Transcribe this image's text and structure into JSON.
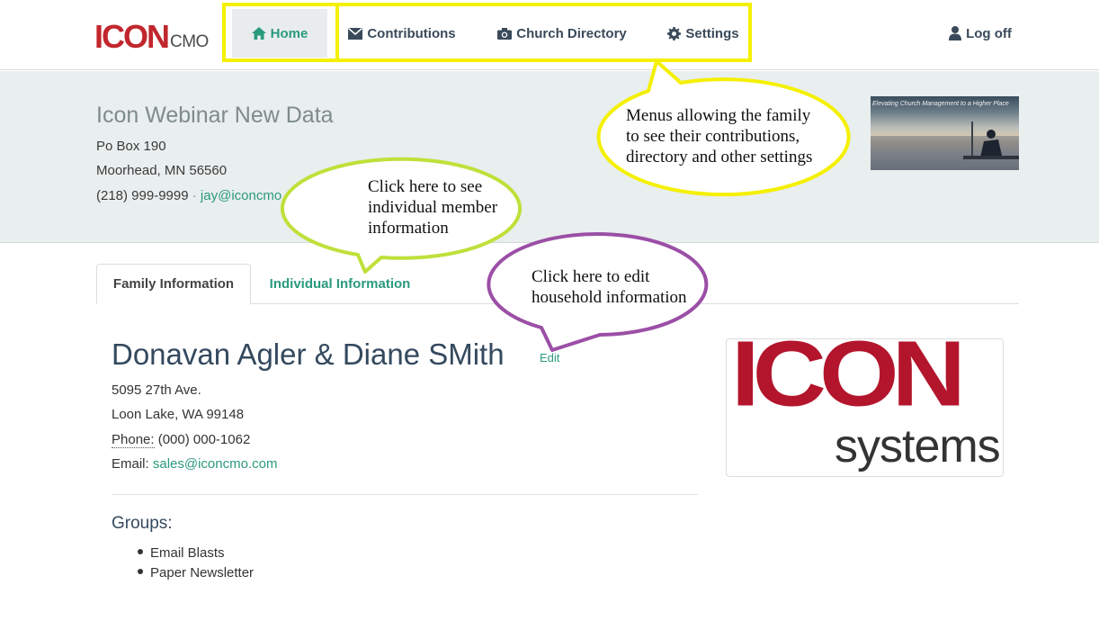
{
  "nav": {
    "logo_main": "ICON",
    "logo_sub": "CMO",
    "home_label": "Home",
    "contributions_label": "Contributions",
    "directory_label": "Church Directory",
    "settings_label": "Settings",
    "logoff_label": "Log off"
  },
  "church": {
    "name": "Icon Webinar New Data",
    "address1": "Po Box 190",
    "address2": "Moorhead, MN 56560",
    "phone": "(218) 999-9999",
    "separator": "·",
    "email": "jay@iconcmo.com",
    "image_caption": "Elevating Church Management to a Higher Place"
  },
  "tabs": [
    {
      "label": "Family Information"
    },
    {
      "label": "Individual Information"
    }
  ],
  "family": {
    "name": "Donavan Agler & Diane SMith",
    "edit_label": "Edit",
    "address1": "5095 27th Ave.",
    "address2": "Loon Lake, WA 99148",
    "phone_label": "Phone:",
    "phone": "(000) 000-1062",
    "email_label": "Email:",
    "email": "sales@iconcmo.com",
    "groups_title": "Groups:",
    "groups": [
      "Email Blasts",
      "Paper Newsletter"
    ],
    "photo_main": "ICON",
    "photo_sub": "systems"
  },
  "callouts": {
    "menus": [
      "Menus allowing the family",
      "to see their contributions,",
      "directory and other settings"
    ],
    "individual": [
      "Click here to see",
      "individual member",
      "information"
    ],
    "edit": [
      "Click here to edit",
      "household information"
    ]
  },
  "colors": {
    "accent": "#2a9a7d",
    "brand_red": "#c1272d",
    "highlight_yellow": "#f4f000",
    "callout_green": "#bfe03a",
    "callout_purple": "#9b4fa6"
  }
}
